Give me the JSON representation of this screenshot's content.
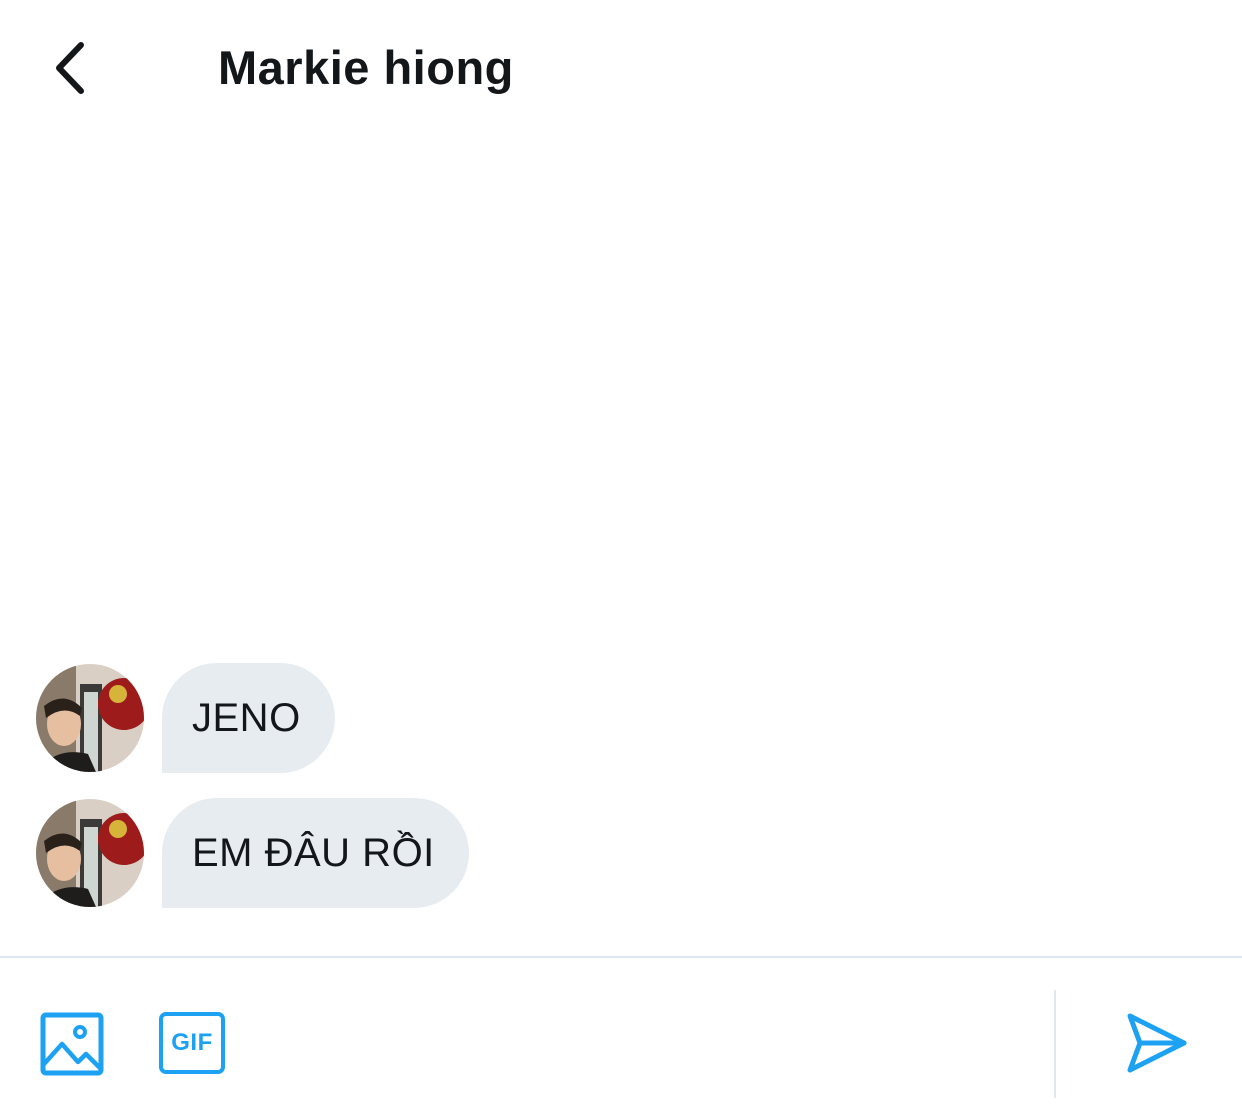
{
  "header": {
    "title": "Markie hiong",
    "back_icon": "chevron-left-icon"
  },
  "messages": [
    {
      "text": "JENO",
      "avatar": "contact-avatar"
    },
    {
      "text": "EM ĐÂU RỒI",
      "avatar": "contact-avatar"
    }
  ],
  "composer": {
    "media_icon": "image-icon",
    "gif_label": "GIF",
    "input_value": "",
    "send_icon": "send-icon"
  },
  "colors": {
    "accent": "#1da1f2",
    "bubble": "#e6ecf0",
    "text": "#14171a",
    "divider": "#e1e8ed"
  }
}
